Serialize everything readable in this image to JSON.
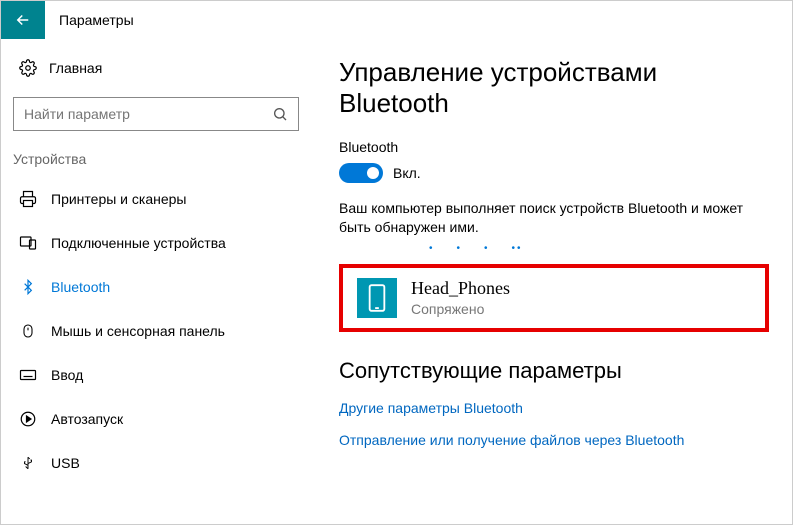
{
  "header": {
    "title": "Параметры"
  },
  "sidebar": {
    "home": "Главная",
    "search_placeholder": "Найти параметр",
    "category": "Устройства",
    "items": [
      {
        "label": "Принтеры и сканеры"
      },
      {
        "label": "Подключенные устройства"
      },
      {
        "label": "Bluetooth"
      },
      {
        "label": "Мышь и сенсорная панель"
      },
      {
        "label": "Ввод"
      },
      {
        "label": "Автозапуск"
      },
      {
        "label": "USB"
      }
    ]
  },
  "main": {
    "title": "Управление устройствами Bluetooth",
    "toggle_label": "Bluetooth",
    "toggle_state": "Вкл.",
    "description": "Ваш компьютер выполняет поиск устройств Bluetooth и может быть обнаружен ими.",
    "device": {
      "name": "Head_Phones",
      "status": "Сопряжено"
    },
    "related_title": "Сопутствующие параметры",
    "links": [
      "Другие параметры Bluetooth",
      "Отправление или получение файлов через Bluetooth"
    ]
  }
}
